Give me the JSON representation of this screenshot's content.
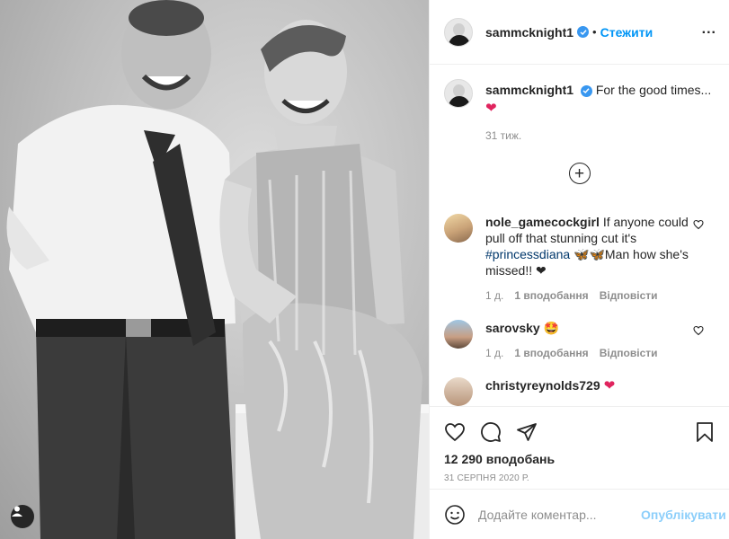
{
  "post": {
    "username": "sammcknight1",
    "follow_label": "Стежити",
    "dot": "•",
    "more_label": "...",
    "caption": "For the good times...",
    "caption_emoji": "❤",
    "caption_time": "31 тиж."
  },
  "comments": [
    {
      "user": "nole_gamecockgirl",
      "text_before": "If anyone could pull off that stunning cut it's ",
      "tag": "#princessdiana",
      "text_after": " 🦋🦋Man how she's missed!! ❤",
      "age": "1 д.",
      "likes": "1 вподобання",
      "reply": "Відповісти"
    },
    {
      "user": "sarovsky",
      "text_before": "🤩",
      "tag": "",
      "text_after": "",
      "age": "1 д.",
      "likes": "1 вподобання",
      "reply": "Відповісти"
    },
    {
      "user": "christyreynolds729",
      "text_before": "❤",
      "tag": "",
      "text_after": "",
      "age": "",
      "likes": "",
      "reply": ""
    }
  ],
  "stats": {
    "likes": "12 290 вподобань",
    "date": "31 СЕРПНЯ 2020 Р."
  },
  "composer": {
    "placeholder": "Додайте коментар...",
    "post_label": "Опублікувати"
  },
  "icons": {
    "like": "heart-outline-icon",
    "comment": "comment-bubble-icon",
    "share": "paper-plane-icon",
    "save": "bookmark-icon",
    "emoji": "smiley-icon",
    "load_more": "plus-circle-icon",
    "tagged_users": "user-tag-icon"
  },
  "colors": {
    "accent": "#0095f6",
    "heart": "#e0245e",
    "verified": "#3897f0"
  }
}
